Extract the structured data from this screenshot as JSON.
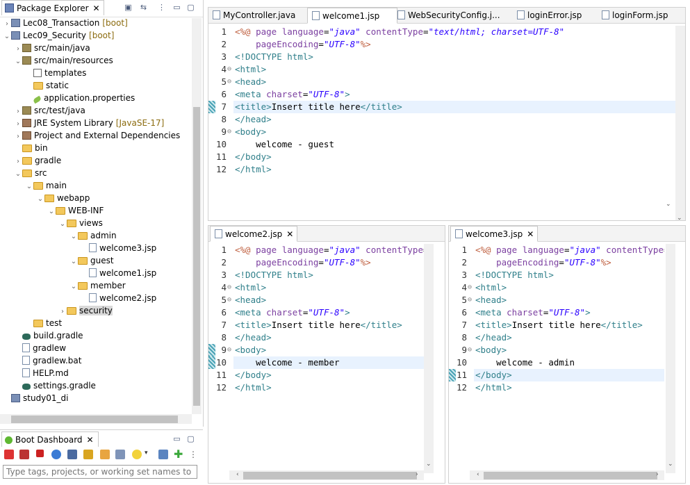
{
  "package_explorer": {
    "title": "Package Explorer",
    "tree": [
      {
        "label": "Lec08_Transaction",
        "deco": "[boot]",
        "icon": "project-icon",
        "twisty": "›"
      },
      {
        "label": "Lec09_Security",
        "deco": "[boot]",
        "icon": "project-icon",
        "twisty": "⌄"
      },
      {
        "label": "src/main/java",
        "icon": "package-folder-icon",
        "twisty": "›"
      },
      {
        "label": "src/main/resources",
        "icon": "package-folder-icon",
        "twisty": "⌄"
      },
      {
        "label": "templates",
        "icon": "grid-folder-icon",
        "twisty": ""
      },
      {
        "label": "static",
        "icon": "folder-icon",
        "twisty": ""
      },
      {
        "label": "application.properties",
        "icon": "spring-leaf-icon",
        "twisty": ""
      },
      {
        "label": "src/test/java",
        "icon": "package-folder-icon",
        "twisty": "›"
      },
      {
        "label": "JRE System Library",
        "deco": "[JavaSE-17]",
        "icon": "library-icon",
        "twisty": "›"
      },
      {
        "label": "Project and External Dependencies",
        "icon": "library-icon",
        "twisty": "›"
      },
      {
        "label": "bin",
        "icon": "folder-icon",
        "twisty": ""
      },
      {
        "label": "gradle",
        "icon": "folder-icon",
        "twisty": "›"
      },
      {
        "label": "src",
        "icon": "folder-icon",
        "twisty": "⌄"
      },
      {
        "label": "main",
        "icon": "folder-icon",
        "twisty": "⌄"
      },
      {
        "label": "webapp",
        "icon": "folder-icon",
        "twisty": "⌄"
      },
      {
        "label": "WEB-INF",
        "icon": "folder-icon",
        "twisty": "⌄"
      },
      {
        "label": "views",
        "icon": "folder-icon",
        "twisty": "⌄"
      },
      {
        "label": "admin",
        "icon": "folder-icon",
        "twisty": "⌄"
      },
      {
        "label": "welcome3.jsp",
        "icon": "jsp-file-icon",
        "twisty": ""
      },
      {
        "label": "guest",
        "icon": "folder-icon",
        "twisty": "⌄"
      },
      {
        "label": "welcome1.jsp",
        "icon": "jsp-file-icon",
        "twisty": ""
      },
      {
        "label": "member",
        "icon": "folder-icon",
        "twisty": "⌄"
      },
      {
        "label": "welcome2.jsp",
        "icon": "jsp-file-icon",
        "twisty": ""
      },
      {
        "label": "security",
        "icon": "folder-icon",
        "twisty": "›"
      },
      {
        "label": "test",
        "icon": "folder-icon",
        "twisty": ""
      },
      {
        "label": "build.gradle",
        "icon": "gradle-icon",
        "twisty": ""
      },
      {
        "label": "gradlew",
        "icon": "file-icon",
        "twisty": ""
      },
      {
        "label": "gradlew.bat",
        "icon": "file-icon",
        "twisty": ""
      },
      {
        "label": "HELP.md",
        "icon": "file-icon",
        "twisty": ""
      },
      {
        "label": "settings.gradle",
        "icon": "gradle-icon",
        "twisty": ""
      },
      {
        "label": "study01_di",
        "icon": "project-icon",
        "twisty": ""
      }
    ]
  },
  "boot_dashboard": {
    "title": "Boot Dashboard",
    "filter_placeholder": "Type tags, projects, or working set names to match"
  },
  "top_editor": {
    "tabs": [
      "MyController.java",
      "welcome1.jsp",
      "WebSecurityConfig.j...",
      "loginError.jsp",
      "loginForm.jsp"
    ],
    "active_tab": "welcome1.jsp",
    "close": "✕"
  },
  "bl_editor": {
    "tab": "welcome2.jsp",
    "close": "✕"
  },
  "br_editor": {
    "tab": "welcome3.jsp",
    "close": "✕"
  },
  "code": {
    "l1a": "<%@ ",
    "l1b": "page ",
    "l1c": "language",
    "l1d": "=",
    "l1e": "\"java\"",
    "l1f": " contentType",
    "l1g": "=",
    "l1h": "\"text/html; charset=UTF-8\"",
    "l1h_trunc": "\"t",
    "l2a": "    pageEncoding",
    "l2b": "=",
    "l2c": "\"UTF-8\"",
    "l2d": "%>",
    "l3": "<!DOCTYPE html>",
    "l4": "<html>",
    "l5": "<head>",
    "l6a": "<meta ",
    "l6b": "charset",
    "l6c": "=",
    "l6d": "\"UTF-8\"",
    "l6e": ">",
    "l7a": "<title>",
    "l7b": "Insert title here",
    "l7c": "</title>",
    "l8": "</head>",
    "l9": "<body>",
    "l10_guest": "    welcome - guest",
    "l10_member": "    welcome - member",
    "l10_admin": "    welcome - admin",
    "l11": "</body>",
    "l12": "</html>"
  },
  "line_numbers": [
    "1",
    "2",
    "3",
    "4",
    "5",
    "6",
    "7",
    "8",
    "9",
    "10",
    "11",
    "12"
  ]
}
